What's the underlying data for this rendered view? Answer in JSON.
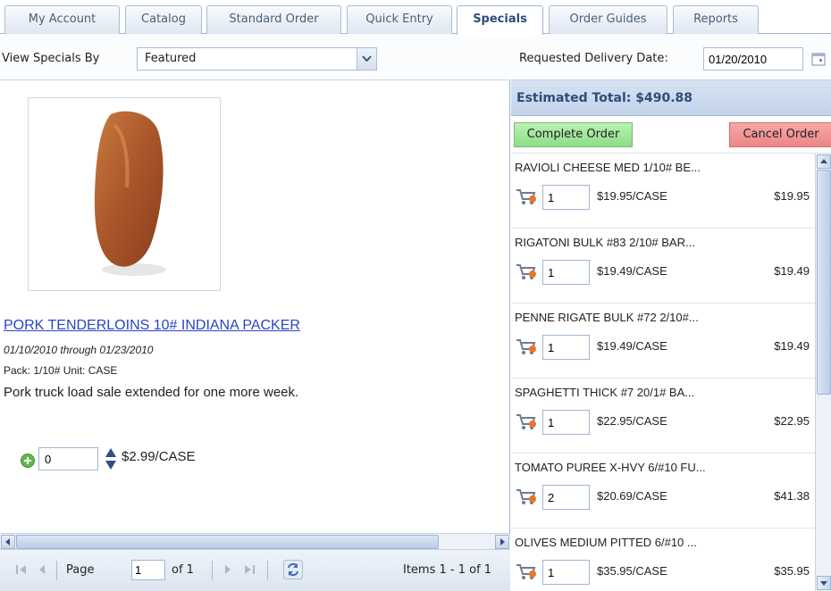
{
  "tabs": [
    {
      "label": "My Account"
    },
    {
      "label": "Catalog"
    },
    {
      "label": "Standard Order"
    },
    {
      "label": "Quick Entry"
    },
    {
      "label": "Specials",
      "active": true
    },
    {
      "label": "Order Guides"
    },
    {
      "label": "Reports"
    }
  ],
  "filter": {
    "label": "View Specials By",
    "selected": "Featured"
  },
  "product": {
    "title": "PORK TENDERLOINS 10# INDIANA PACKER",
    "dates": "01/10/2010 through 01/23/2010",
    "pack": "Pack: 1/10# Unit: CASE",
    "description": "Pork truck load sale extended for one more week.",
    "quantity": "0",
    "price": "$2.99/CASE",
    "image_icon": "pork-tenderloin-image"
  },
  "pager": {
    "page_label": "Page",
    "page_value": "1",
    "of_label": "of 1",
    "items": "Items 1 - 1 of 1"
  },
  "delivery": {
    "label": "Requested Delivery Date:",
    "date": "01/20/2010"
  },
  "estimated_total": "Estimated Total: $490.88",
  "actions": {
    "complete": "Complete Order",
    "cancel": "Cancel Order"
  },
  "order_items": [
    {
      "name": "RAVIOLI CHEESE MED 1/10# BE...",
      "qty": "1",
      "unit_price": "$19.95/CASE",
      "total": "$19.95"
    },
    {
      "name": "RIGATONI BULK #83 2/10# BAR...",
      "qty": "1",
      "unit_price": "$19.49/CASE",
      "total": "$19.49"
    },
    {
      "name": "PENNE RIGATE BULK #72 2/10#...",
      "qty": "1",
      "unit_price": "$19.49/CASE",
      "total": "$19.49"
    },
    {
      "name": "SPAGHETTI THICK #7 20/1# BA...",
      "qty": "1",
      "unit_price": "$22.95/CASE",
      "total": "$22.95"
    },
    {
      "name": "TOMATO PUREE X-HVY 6/#10 FU...",
      "qty": "2",
      "unit_price": "$20.69/CASE",
      "total": "$41.38"
    },
    {
      "name": "OLIVES MEDIUM PITTED 6/#10 ...",
      "qty": "1",
      "unit_price": "$35.95/CASE",
      "total": "$35.95"
    }
  ],
  "colors": {
    "tab_border": "#a9bdd6",
    "link": "#2a43c9",
    "complete_button": "#9fe39a",
    "cancel_button": "#f09595",
    "total_bar": "#c8d8ec"
  }
}
